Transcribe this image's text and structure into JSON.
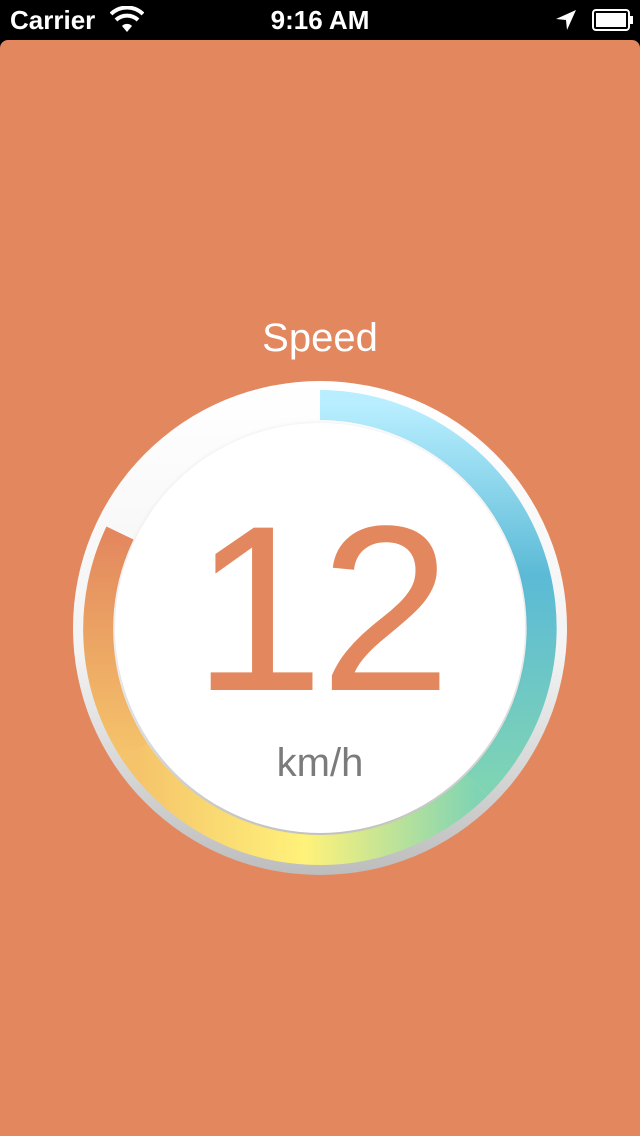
{
  "status_bar": {
    "carrier": "Carrier",
    "time": "9:16 AM",
    "icons": [
      "wifi-icon",
      "location-arrow-icon",
      "battery-icon"
    ]
  },
  "speedometer": {
    "title": "Speed",
    "value": "12",
    "unit": "km/h",
    "arc_colors": [
      "#B8EEFF",
      "#5BBAD6",
      "#7FD4B4",
      "#FFF27A",
      "#F5B360",
      "#E3875E"
    ]
  },
  "theme": {
    "background": "#E3875E",
    "accent": "#E3875E",
    "text_light": "#FFFFFF",
    "unit_text": "#7B7B7B"
  }
}
